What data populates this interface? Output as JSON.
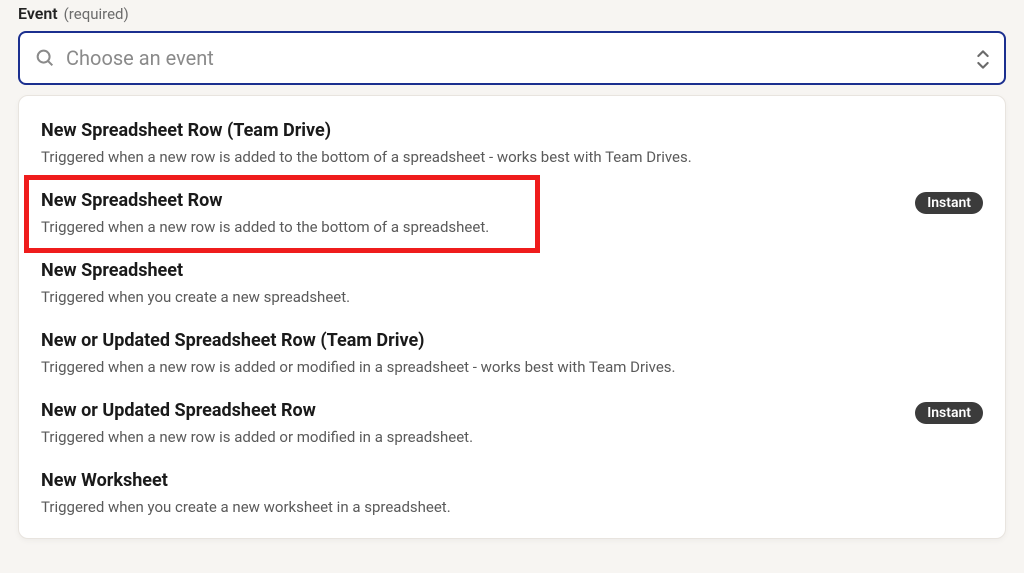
{
  "field": {
    "label": "Event",
    "required_text": "(required)"
  },
  "select": {
    "placeholder": "Choose an event"
  },
  "badge_text": "Instant",
  "options": [
    {
      "title": "New Spreadsheet Row (Team Drive)",
      "desc": "Triggered when a new row is added to the bottom of a spreadsheet - works best with Team Drives.",
      "instant": false
    },
    {
      "title": "New Spreadsheet Row",
      "desc": "Triggered when a new row is added to the bottom of a spreadsheet.",
      "instant": true
    },
    {
      "title": "New Spreadsheet",
      "desc": "Triggered when you create a new spreadsheet.",
      "instant": false
    },
    {
      "title": "New or Updated Spreadsheet Row (Team Drive)",
      "desc": "Triggered when a new row is added or modified in a spreadsheet - works best with Team Drives.",
      "instant": false
    },
    {
      "title": "New or Updated Spreadsheet Row",
      "desc": "Triggered when a new row is added or modified in a spreadsheet.",
      "instant": true
    },
    {
      "title": "New Worksheet",
      "desc": "Triggered when you create a new worksheet in a spreadsheet.",
      "instant": false
    }
  ]
}
